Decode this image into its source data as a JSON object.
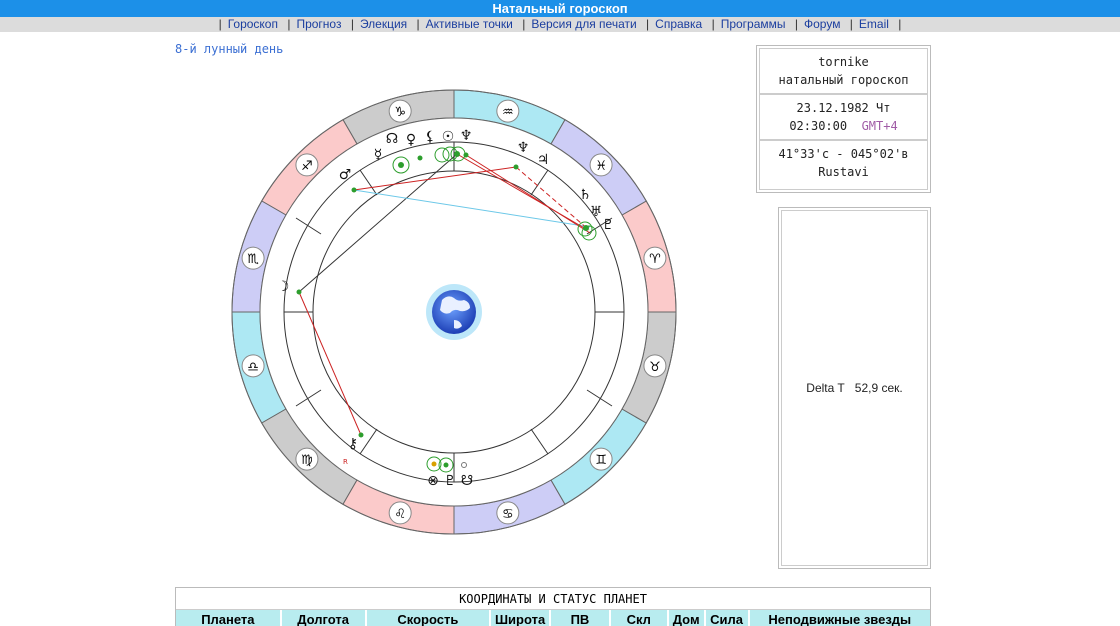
{
  "title": "Натальный гороскоп",
  "menu": [
    "Гороскоп",
    "Прогноз",
    "Элекция",
    "Активные точки",
    "Версия для печати",
    "Справка",
    "Программы",
    "Форум",
    "Email"
  ],
  "lunar_day": "8-й лунный день",
  "info": {
    "name": "tornike",
    "type": "натальный гороскоп",
    "date": "23.12.1982 Чт",
    "time": "02:30:00",
    "gmt": "GMT+4",
    "coords": "41°33'с - 045°02'в",
    "city": "Rustavi"
  },
  "delta": {
    "label": "Delta T",
    "value": "52,9 сек."
  },
  "table": {
    "caption": "КООРДИНАТЫ И СТАТУС ПЛАНЕТ",
    "headers": [
      "Планета",
      "Долгота",
      "Скорость",
      "Широта",
      "ПВ",
      "Скл",
      "Дом",
      "Сила",
      "Неподвижные звезды"
    ]
  },
  "zodiac": [
    {
      "sign": "aquarius",
      "glyph": "♒",
      "color": "#ade8f3"
    },
    {
      "sign": "capricorn",
      "glyph": "♑",
      "color": "#cccccc"
    },
    {
      "sign": "sagittarius",
      "glyph": "♐",
      "color": "#fbcaca"
    },
    {
      "sign": "scorpio",
      "glyph": "♏",
      "color": "#cdcdf6"
    },
    {
      "sign": "libra",
      "glyph": "♎",
      "color": "#ade8f3"
    },
    {
      "sign": "virgo",
      "glyph": "♍",
      "color": "#cccccc"
    },
    {
      "sign": "leo",
      "glyph": "♌",
      "color": "#fbcaca"
    },
    {
      "sign": "cancer",
      "glyph": "♋",
      "color": "#cdcdf6"
    },
    {
      "sign": "gemini",
      "glyph": "♊",
      "color": "#ade8f3"
    },
    {
      "sign": "taurus",
      "glyph": "♉",
      "color": "#cccccc"
    },
    {
      "sign": "aries",
      "glyph": "♈",
      "color": "#fbcaca"
    },
    {
      "sign": "pisces",
      "glyph": "♓",
      "color": "#cdcdf6"
    }
  ],
  "planets": [
    {
      "name": "pluto",
      "glyph": "♇"
    },
    {
      "name": "uranus",
      "glyph": "♅"
    },
    {
      "name": "saturn",
      "glyph": "♄"
    },
    {
      "name": "jupiter",
      "glyph": "♃"
    },
    {
      "name": "mercury",
      "glyph": "☿"
    },
    {
      "name": "neptune",
      "glyph": "♆"
    },
    {
      "name": "sun",
      "glyph": "☉"
    },
    {
      "name": "lilith",
      "glyph": "⚸"
    },
    {
      "name": "venus",
      "glyph": "♀"
    },
    {
      "name": "selena",
      "glyph": "♆"
    },
    {
      "name": "north-node",
      "glyph": "☊"
    },
    {
      "name": "mars",
      "glyph": "♂"
    },
    {
      "name": "moon",
      "glyph": "☽"
    },
    {
      "name": "chiron",
      "glyph": "⚷"
    },
    {
      "name": "part-of-fortune",
      "glyph": "⊗"
    },
    {
      "name": "rahu",
      "glyph": "♇"
    },
    {
      "name": "south-node",
      "glyph": "☋"
    }
  ],
  "retrograde_mark": "R"
}
